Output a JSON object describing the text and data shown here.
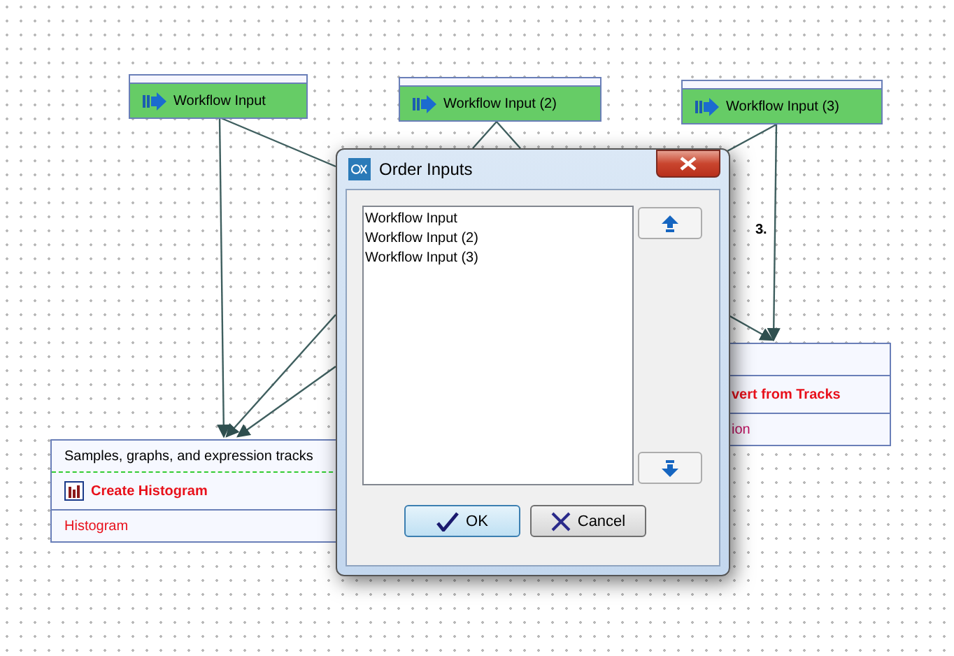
{
  "workflow_inputs": [
    {
      "label": "Workflow Input"
    },
    {
      "label": "Workflow Input (2)"
    },
    {
      "label": "Workflow Input (3)"
    }
  ],
  "connector_label": "3.",
  "tool_nodes": [
    {
      "input": "Samples, graphs, and expression tracks",
      "tool": "Create Histogram",
      "output": "Histogram"
    },
    {
      "tool": "vert from Tracks",
      "output": "ion"
    }
  ],
  "dialog": {
    "title": "Order Inputs",
    "items": [
      "Workflow Input",
      "Workflow Input (2)",
      "Workflow Input (3)"
    ],
    "buttons": [
      {
        "kind": "ok",
        "label": "OK"
      },
      {
        "kind": "cancel",
        "label": "Cancel"
      }
    ]
  }
}
